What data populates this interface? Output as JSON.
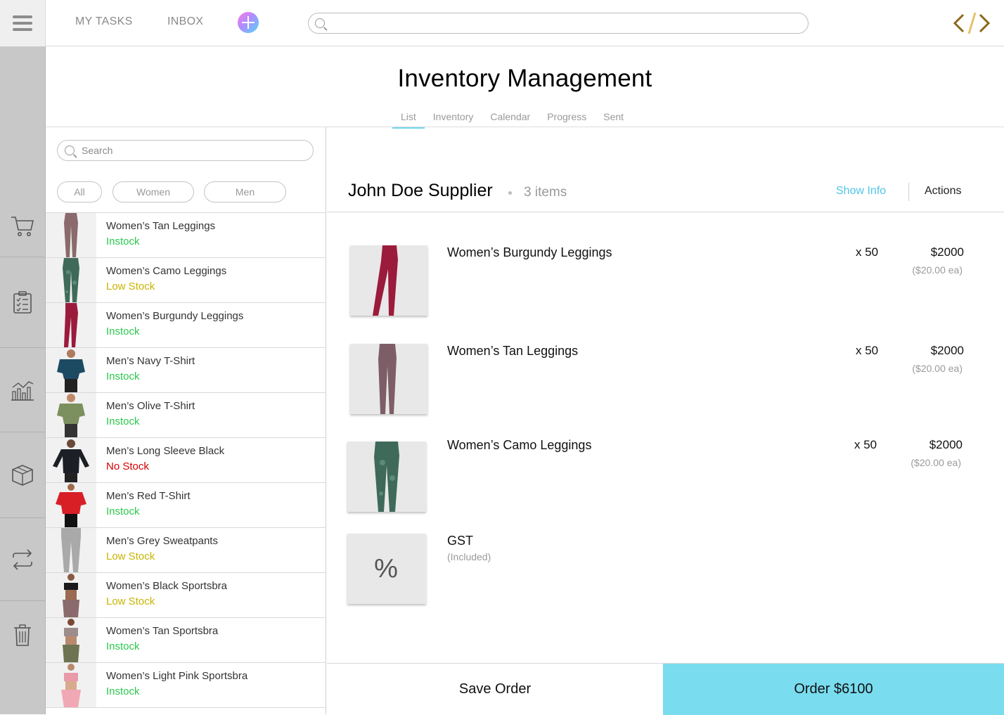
{
  "topbar": {
    "tasks_label": "MY TASKS",
    "inbox_label": "INBOX",
    "search_placeholder": "",
    "accent": "#79dcef"
  },
  "sidebar": {
    "items": [
      {
        "icon": "cart-icon"
      },
      {
        "icon": "clipboard-icon"
      },
      {
        "icon": "chart-icon"
      },
      {
        "icon": "box-icon"
      },
      {
        "icon": "transfer-icon"
      },
      {
        "icon": "trash-icon"
      }
    ]
  },
  "header": {
    "title": "Inventory Management",
    "tabs": [
      {
        "label": "List",
        "active": true
      },
      {
        "label": "Inventory"
      },
      {
        "label": "Calendar"
      },
      {
        "label": "Progress"
      },
      {
        "label": "Sent"
      }
    ]
  },
  "list": {
    "search_placeholder": "Search",
    "filters": [
      "All",
      "Women",
      "Men"
    ],
    "items": [
      {
        "name": "Women’s Tan Leggings",
        "status": "Instock",
        "level": "in"
      },
      {
        "name": "Women’s Camo Leggings",
        "status": "Low Stock",
        "level": "low"
      },
      {
        "name": "Women’s Burgundy Leggings",
        "status": "Instock",
        "level": "in"
      },
      {
        "name": "Men’s Navy T-Shirt",
        "status": "Instock",
        "level": "in"
      },
      {
        "name": "Men’s Olive T-Shirt",
        "status": "Instock",
        "level": "in"
      },
      {
        "name": "Men’s Long Sleeve Black",
        "status": "No Stock",
        "level": "no"
      },
      {
        "name": "Men’s Red T-Shirt",
        "status": "Instock",
        "level": "in"
      },
      {
        "name": "Men’s Grey Sweatpants",
        "status": "Low Stock",
        "level": "low"
      },
      {
        "name": "Women’s Black Sportsbra",
        "status": "Low Stock",
        "level": "low"
      },
      {
        "name": "Women’s Tan Sportsbra",
        "status": "Instock",
        "level": "in"
      },
      {
        "name": "Women’s Light Pink Sportsbra",
        "status": "Instock",
        "level": "in"
      }
    ]
  },
  "order": {
    "supplier": "John Doe Supplier",
    "count": "3 items",
    "show_info": "Show Info",
    "actions": "Actions",
    "lines": [
      {
        "name": "Women’s Burgundy Leggings",
        "qty": "x 50",
        "total": "$2000",
        "each": "($20.00 ea)"
      },
      {
        "name": "Women’s Tan Leggings",
        "qty": "x 50",
        "total": "$2000",
        "each": "($20.00 ea)"
      },
      {
        "name": "Women’s Camo Leggings",
        "qty": "x 50",
        "total": "$2000",
        "each": "($20.00 ea)"
      }
    ],
    "gst": {
      "name": "GST",
      "note": "(Included)",
      "symbol": "%"
    },
    "save_label": "Save Order",
    "order_label": "Order $6100"
  }
}
